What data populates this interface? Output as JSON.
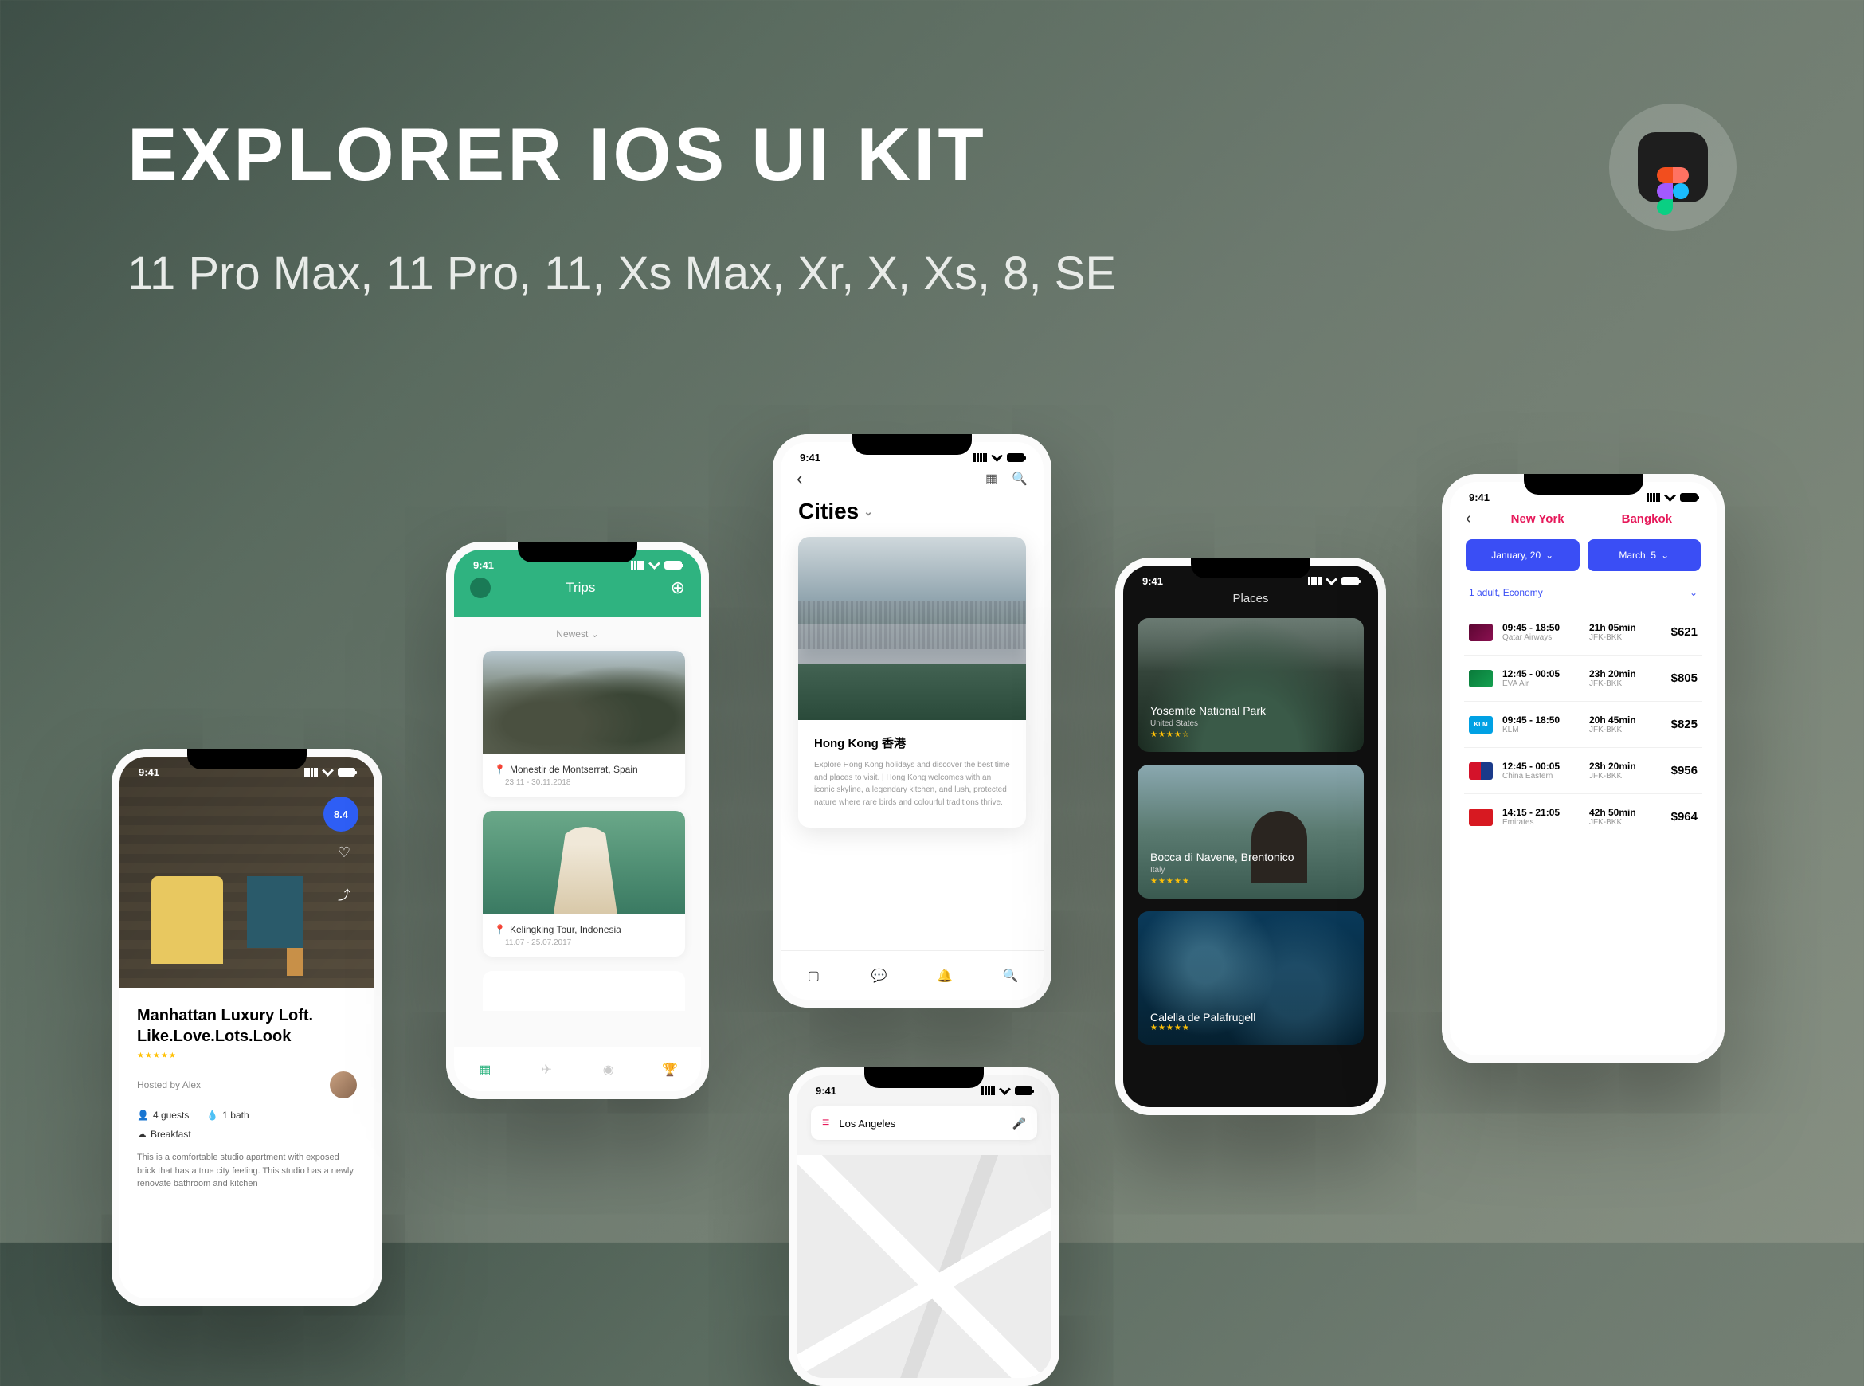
{
  "hero": {
    "title": "EXPLORER IOS UI KIT",
    "subtitle": "11 Pro Max, 11 Pro, 11, Xs Max, Xr, X, Xs, 8, SE"
  },
  "status_time": "9:41",
  "p1": {
    "rating": "8.4",
    "title": "Manhattan Luxury Loft. Like.Love.Lots.Look",
    "stars": "★★★★★",
    "host": "Hosted by Alex",
    "guests": "4 guests",
    "bath": "1 bath",
    "breakfast": "Breakfast",
    "desc": "This is a comfortable studio apartment with exposed brick that has a true city feeling. This studio has a newly renovate bathroom and kitchen"
  },
  "p2": {
    "title": "Trips",
    "sort": "Newest",
    "year1": "2018",
    "year2": "2017",
    "card1": {
      "loc": "Monestir de Montserrat, Spain",
      "dates": "23.11 - 30.11.2018"
    },
    "card2": {
      "loc": "Kelingking Tour, Indonesia",
      "dates": "11.07 - 25.07.2017"
    }
  },
  "p3": {
    "heading": "Cities",
    "name": "Hong Kong 香港",
    "blurb": "Explore Hong Kong holidays and discover the best time and places to visit. | Hong Kong welcomes with an iconic skyline, a legendary kitchen, and lush, protected nature where rare birds and colourful traditions thrive."
  },
  "p4": {
    "search": "Los Angeles"
  },
  "p5": {
    "title": "Places",
    "t1": {
      "name": "Yosemite National Park",
      "sub": "United States",
      "stars": "★★★★☆"
    },
    "t2": {
      "name": "Bocca di Navene, Brentonico",
      "sub": "Italy",
      "stars": "★★★★★"
    },
    "t3": {
      "name": "Calella de Palafrugell",
      "stars": "★★★★★"
    }
  },
  "p6": {
    "from": "New York",
    "to": "Bangkok",
    "date1": "January, 20",
    "date2": "March, 5",
    "pax": "1 adult, Economy",
    "route": "JFK-BKK",
    "flights": [
      {
        "time": "09:45 - 18:50",
        "airline": "Qatar Airways",
        "dur": "21h 05min",
        "price": "$621"
      },
      {
        "time": "12:45 - 00:05",
        "airline": "EVA Air",
        "dur": "23h 20min",
        "price": "$805"
      },
      {
        "time": "09:45 - 18:50",
        "airline": "KLM",
        "dur": "20h 45min",
        "price": "$825"
      },
      {
        "time": "12:45 - 00:05",
        "airline": "China Eastern",
        "dur": "23h 20min",
        "price": "$956"
      },
      {
        "time": "14:15 - 21:05",
        "airline": "Emirates",
        "dur": "42h 50min",
        "price": "$964"
      }
    ]
  }
}
